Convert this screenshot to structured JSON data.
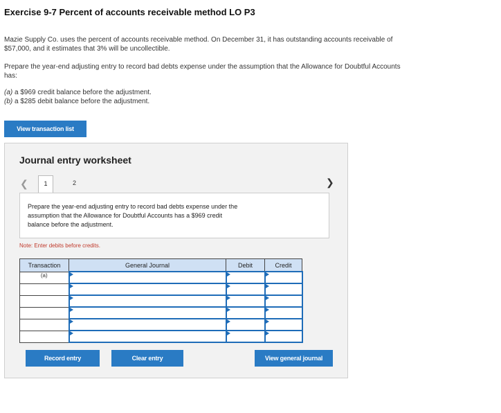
{
  "header": {
    "title": "Exercise 9-7 Percent of accounts receivable method LO P3"
  },
  "problem": {
    "paragraph1_line1": "Mazie Supply Co. uses the percent of accounts receivable method. On December 31, it has outstanding accounts receivable of",
    "paragraph1_line2": "$57,000, and it estimates that 3% will be uncollectible.",
    "paragraph2_line1": "Prepare the year-end adjusting entry to record bad debts expense under the assumption that the Allowance for Doubtful Accounts",
    "paragraph2_line2": "has:",
    "option_a_label": "(a)",
    "option_a_text": " a $969 credit balance before the adjustment.",
    "option_b_label": "(b)",
    "option_b_text": " a $285 debit balance before the adjustment."
  },
  "buttons": {
    "view_transaction_list": "View transaction list",
    "record_entry": "Record entry",
    "clear_entry": "Clear entry",
    "view_general_journal": "View general journal"
  },
  "worksheet": {
    "title": "Journal entry worksheet",
    "prev_icon": "chevron-left-icon",
    "next_icon": "chevron-right-icon",
    "tabs": [
      "1",
      "2"
    ],
    "instruction_line1": "Prepare the year-end adjusting entry to record bad debts expense under the",
    "instruction_line2": "assumption that the Allowance for Doubtful Accounts has a $969 credit",
    "instruction_line3": "balance before the adjustment.",
    "note": "Note: Enter debits before credits."
  },
  "journal_table": {
    "headers": {
      "transaction": "Transaction",
      "general_journal": "General Journal",
      "debit": "Debit",
      "credit": "Credit"
    },
    "rows": [
      {
        "transaction": "(a)",
        "account": "",
        "debit": "",
        "credit": ""
      },
      {
        "transaction": "",
        "account": "",
        "debit": "",
        "credit": ""
      },
      {
        "transaction": "",
        "account": "",
        "debit": "",
        "credit": ""
      },
      {
        "transaction": "",
        "account": "",
        "debit": "",
        "credit": ""
      },
      {
        "transaction": "",
        "account": "",
        "debit": "",
        "credit": ""
      },
      {
        "transaction": "",
        "account": "",
        "debit": "",
        "credit": ""
      }
    ]
  },
  "colors": {
    "button_blue": "#2a7bc4",
    "header_blue": "#cfe0f4",
    "note_red": "#c0392b",
    "input_border_blue": "#1e6cb8"
  }
}
